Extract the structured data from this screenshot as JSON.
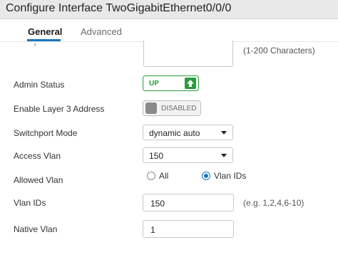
{
  "header": {
    "title": "Configure Interface TwoGigabitEthernet0/0/0"
  },
  "tabs": {
    "general": "General",
    "advanced": "Advanced"
  },
  "description": {
    "hint": "(1-200 Characters)",
    "stray_mark": "'"
  },
  "admin_status": {
    "label": "Admin Status",
    "value": "UP",
    "icon": "arrow-up-icon",
    "color": "#2a9b3b"
  },
  "layer3": {
    "label": "Enable Layer 3 Address",
    "value": "DISABLED"
  },
  "switchport_mode": {
    "label": "Switchport Mode",
    "value": "dynamic auto"
  },
  "access_vlan": {
    "label": "Access Vlan",
    "value": "150"
  },
  "allowed_vlan": {
    "label": "Allowed Vlan",
    "options": [
      "All",
      "Vlan IDs"
    ],
    "selected": "Vlan IDs"
  },
  "vlan_ids": {
    "label": "Vlan IDs",
    "value": "150",
    "hint": "(e.g. 1,2,4,6-10)"
  },
  "native_vlan": {
    "label": "Native Vlan",
    "value": "1"
  },
  "colors": {
    "accent": "#1b75bc",
    "header_bg": "#e9e9e9"
  }
}
